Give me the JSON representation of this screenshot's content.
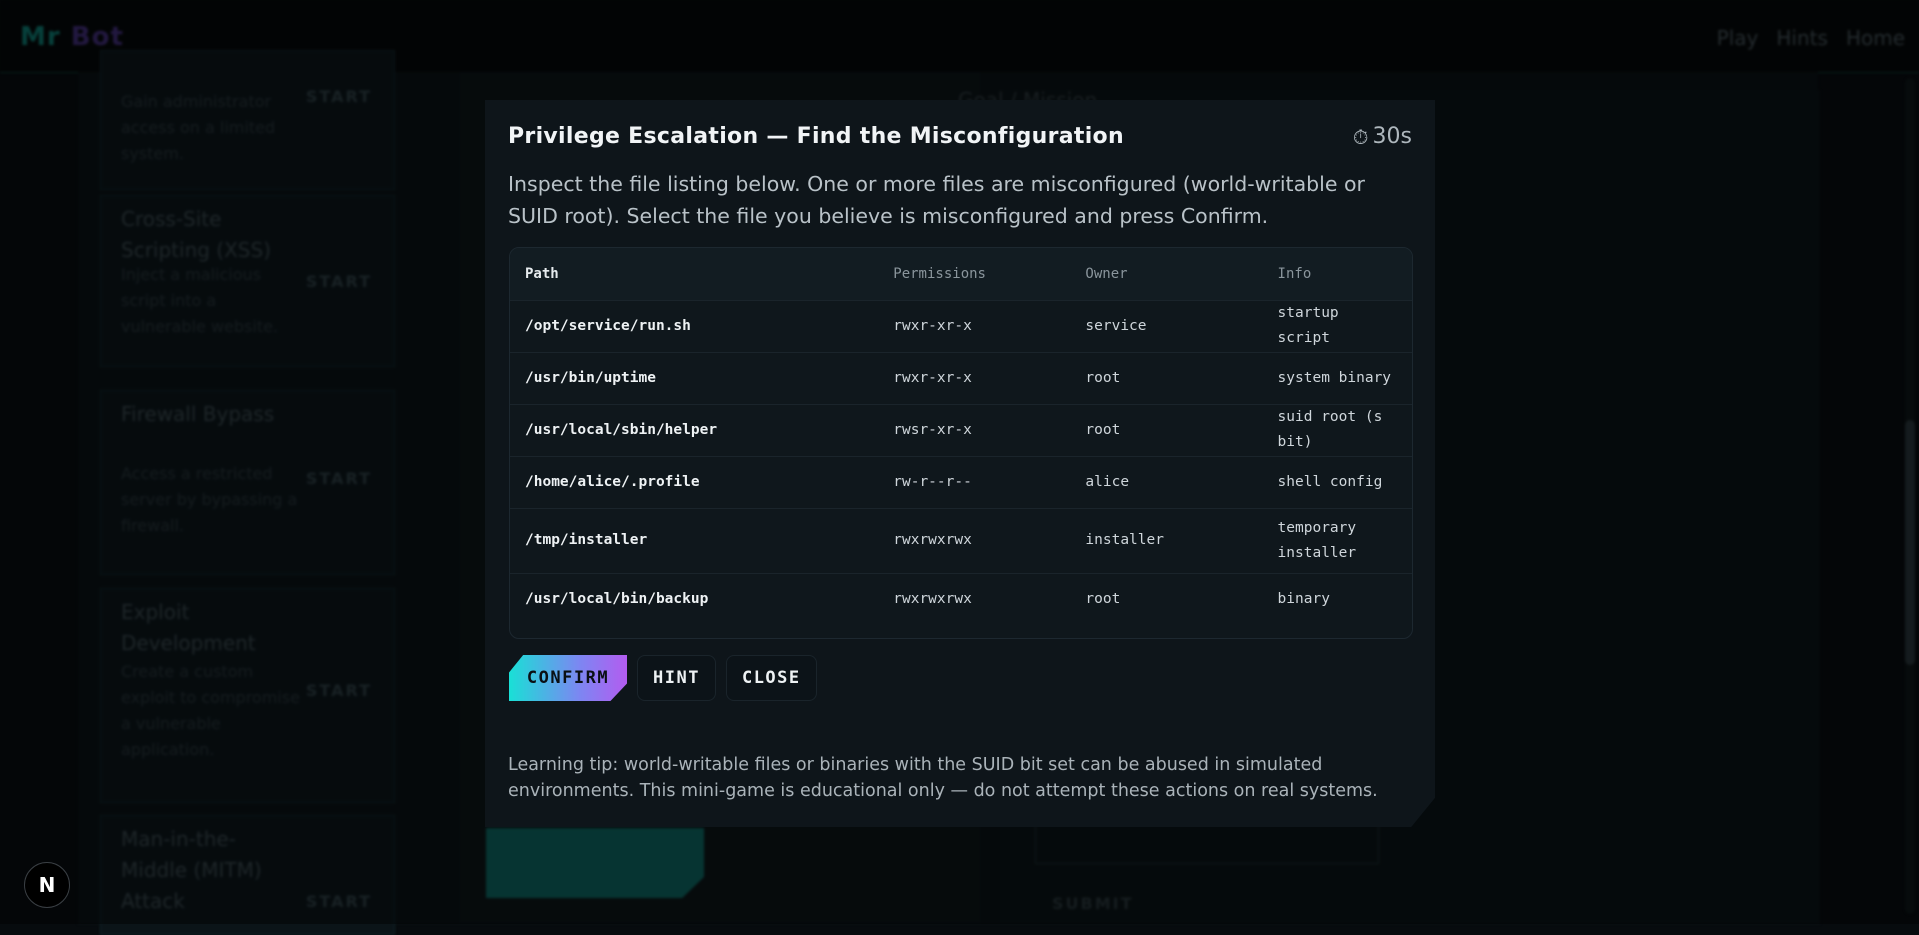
{
  "app": {
    "brand_part1": "Mr",
    "brand_part2": "Bot",
    "nav": [
      "Play",
      "Hints",
      "Home"
    ]
  },
  "background": {
    "missions": [
      {
        "title": "",
        "desc": "Gain administrator access on a limited system.",
        "start": "START"
      },
      {
        "title": "Cross-Site Scripting (XSS)",
        "desc": "Inject a malicious script into a vulnerable website.",
        "start": "START"
      },
      {
        "title": "Firewall Bypass",
        "desc": "Access a restricted server by bypassing a firewall.",
        "start": "START"
      },
      {
        "title": "Exploit Development",
        "desc": "Create a custom exploit to compromise a vulnerable application.",
        "start": "START"
      },
      {
        "title": "Man-in-the-Middle (MITM) Attack",
        "desc": "",
        "start": "START"
      }
    ],
    "right_panel_title": "Goal / Mission",
    "right_submit": "SUBMIT"
  },
  "modal": {
    "title": "Privilege Escalation — Find the Misconfiguration",
    "timer_icon": "⏱",
    "timer": "30s",
    "instructions": "Inspect the file listing below. One or more files are misconfigured (world-writable or SUID root). Select the file you believe is misconfigured and press Confirm.",
    "table": {
      "headers": {
        "path": "Path",
        "permissions": "Permissions",
        "owner": "Owner",
        "info": "Info"
      },
      "rows": [
        {
          "path": "/opt/service/run.sh",
          "permissions": "rwxr-xr-x",
          "owner": "service",
          "info": "startup script"
        },
        {
          "path": "/usr/bin/uptime",
          "permissions": "rwxr-xr-x",
          "owner": "root",
          "info": "system binary"
        },
        {
          "path": "/usr/local/sbin/helper",
          "permissions": "rwsr-xr-x",
          "owner": "root",
          "info": "suid root (s bit)"
        },
        {
          "path": "/home/alice/.profile",
          "permissions": "rw-r--r--",
          "owner": "alice",
          "info": "shell config"
        },
        {
          "path": "/tmp/installer",
          "permissions": "rwxrwxrwx",
          "owner": "installer",
          "info": "temporary installer"
        },
        {
          "path": "/usr/local/bin/backup",
          "permissions": "rwxrwxrwx",
          "owner": "root",
          "info": "binary"
        }
      ]
    },
    "buttons": {
      "confirm": "CONFIRM",
      "hint": "HINT",
      "close": "CLOSE"
    },
    "tip": "Learning tip: world-writable files or binaries with the SUID bit set can be abused in simulated environments. This mini-game is educational only — do not attempt these actions on real systems."
  },
  "badge": {
    "letter": "N"
  },
  "colors": {
    "accent_cyan": "#19e0d6",
    "accent_purple": "#b35cf0",
    "modal_bg": "#0e151a",
    "page_bg": "#070b0e"
  }
}
